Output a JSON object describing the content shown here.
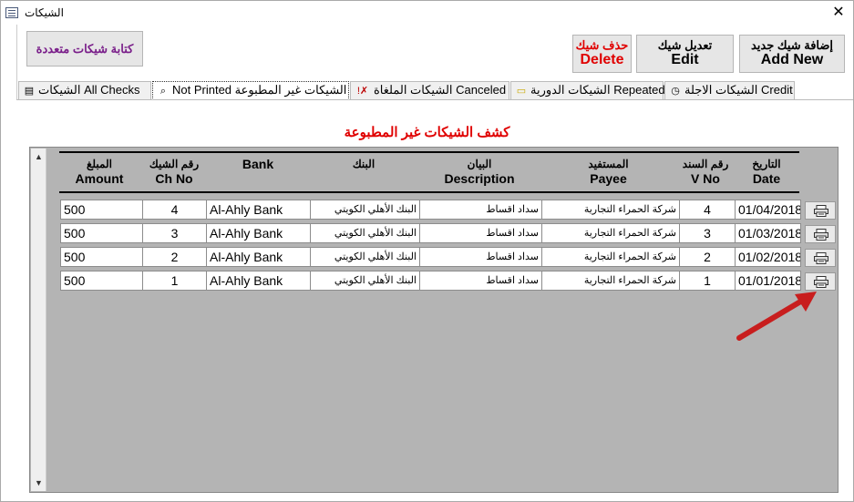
{
  "window": {
    "title": "الشيكات",
    "close_glyph": "✕"
  },
  "toolbar": {
    "multi_label": "كتابة شيكات متعددة",
    "delete_ar": "حذف شيك",
    "delete_en": "Delete",
    "edit_ar": "تعديل شيك",
    "edit_en": "Edit",
    "add_ar": "إضافة شيك جديد",
    "add_en": "Add New"
  },
  "tabs": [
    {
      "label": "الشيكات All Checks",
      "icon": "report-icon"
    },
    {
      "label": "Not Printed الشيكات غير المطبوعة",
      "icon": "print-preview-icon",
      "active": true
    },
    {
      "label": "الشيكات الملغاة Canceled",
      "icon": "cancel-icon",
      "prefix": "!✗"
    },
    {
      "label": "الشيكات الدورية Repeated",
      "icon": "folder-icon"
    },
    {
      "label": "الشيكات الاجلة Credit",
      "icon": "clock-icon"
    }
  ],
  "report": {
    "title": "كشف الشيكات غير المطبوعة"
  },
  "columns": {
    "date": {
      "ar": "التاريخ",
      "en": "Date"
    },
    "vno": {
      "ar": "رقم السند",
      "en": "V No"
    },
    "payee": {
      "ar": "المستفيد",
      "en": "Payee"
    },
    "desc": {
      "ar": "البيان",
      "en": "Description"
    },
    "bank_ar": {
      "ar": "البنك",
      "en": ""
    },
    "bank_en": {
      "ar": "",
      "en": "Bank"
    },
    "chno": {
      "ar": "رقم الشيك",
      "en": "Ch No"
    },
    "amount": {
      "ar": "المبلغ",
      "en": "Amount"
    }
  },
  "rows": [
    {
      "date": "01/04/2018",
      "vno": "4",
      "payee": "شركة الحمراء التجارية",
      "desc": "سداد اقساط",
      "bank_ar": "البنك الأهلي الكويتي",
      "bank_en": "Al-Ahly Bank",
      "chno": "4",
      "amount": "500"
    },
    {
      "date": "01/03/2018",
      "vno": "3",
      "payee": "شركة الحمراء التجارية",
      "desc": "سداد اقساط",
      "bank_ar": "البنك الأهلي الكويتي",
      "bank_en": "Al-Ahly Bank",
      "chno": "3",
      "amount": "500"
    },
    {
      "date": "01/02/2018",
      "vno": "2",
      "payee": "شركة الحمراء التجارية",
      "desc": "سداد اقساط",
      "bank_ar": "البنك الأهلي الكويتي",
      "bank_en": "Al-Ahly Bank",
      "chno": "2",
      "amount": "500"
    },
    {
      "date": "01/01/2018",
      "vno": "1",
      "payee": "شركة الحمراء التجارية",
      "desc": "سداد اقساط",
      "bank_ar": "البنك الأهلي الكويتي",
      "bank_en": "Al-Ahly Bank",
      "chno": "1",
      "amount": "500"
    }
  ],
  "colors": {
    "accent_red": "#e00000",
    "multi_purple": "#7a1f8a",
    "arrow_red": "#c81e1e",
    "grid_bg": "#b4b4b4"
  }
}
